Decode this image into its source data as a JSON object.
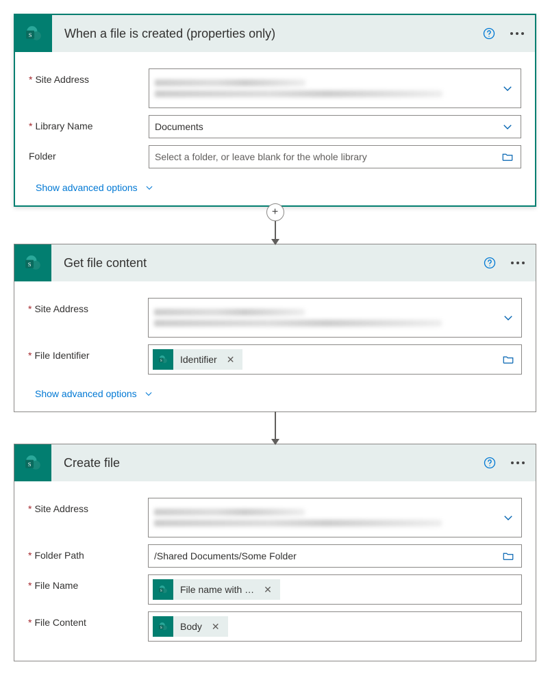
{
  "card1": {
    "title": "When a file is created (properties only)",
    "fields": {
      "siteAddress": {
        "label": "Site Address"
      },
      "libraryName": {
        "label": "Library Name",
        "value": "Documents"
      },
      "folder": {
        "label": "Folder",
        "placeholder": "Select a folder, or leave blank for the whole library"
      }
    },
    "advanced": "Show advanced options"
  },
  "card2": {
    "title": "Get file content",
    "fields": {
      "siteAddress": {
        "label": "Site Address"
      },
      "fileIdentifier": {
        "label": "File Identifier",
        "token": "Identifier"
      }
    },
    "advanced": "Show advanced options"
  },
  "card3": {
    "title": "Create file",
    "fields": {
      "siteAddress": {
        "label": "Site Address"
      },
      "folderPath": {
        "label": "Folder Path",
        "value": "/Shared Documents/Some Folder"
      },
      "fileName": {
        "label": "File Name",
        "token": "File name with …"
      },
      "fileContent": {
        "label": "File Content",
        "token": "Body"
      }
    }
  }
}
